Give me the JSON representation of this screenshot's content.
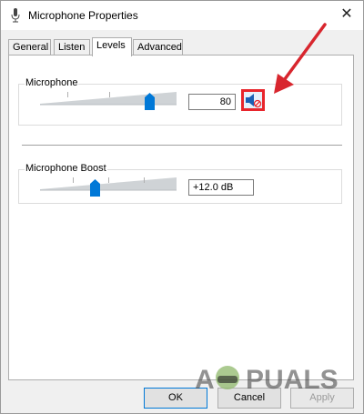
{
  "window": {
    "title": "Microphone Properties",
    "close_glyph": "✕"
  },
  "tabs": [
    {
      "label": "General",
      "active": false
    },
    {
      "label": "Listen",
      "active": false
    },
    {
      "label": "Levels",
      "active": true
    },
    {
      "label": "Advanced",
      "active": false
    }
  ],
  "levels": {
    "microphone": {
      "label": "Microphone",
      "value_text": "80",
      "level_fraction": 0.8,
      "mute_icon": "speaker-muted-icon"
    },
    "boost": {
      "label": "Microphone Boost",
      "value_text": "+12.0 dB",
      "level_fraction": 0.4
    }
  },
  "buttons": {
    "ok": "OK",
    "cancel": "Cancel",
    "apply": "Apply"
  },
  "watermark": {
    "text": "A PUALS"
  },
  "colors": {
    "accent_blue": "#0078d7",
    "highlight_red": "#e8252c",
    "arrow_red": "#d8262e"
  }
}
